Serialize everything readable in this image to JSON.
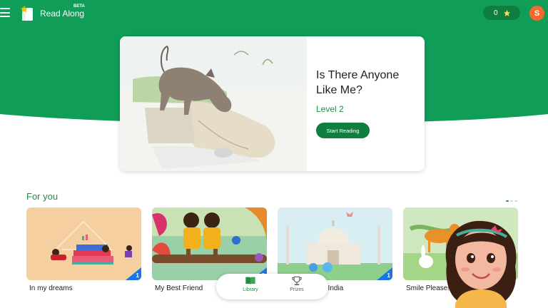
{
  "header": {
    "app_title": "Read Along",
    "beta": "BETA",
    "stars_count": "0",
    "avatar_initial": "S"
  },
  "featured": {
    "title": "Is There Anyone Like Me?",
    "level": "Level 2",
    "button_label": "Start  Reading"
  },
  "for_you": {
    "section_title": "For you",
    "books": [
      {
        "title": "In my dreams",
        "badge": "1"
      },
      {
        "title": "My Best Friend",
        "badge": "2"
      },
      {
        "title": "in India",
        "badge": "1"
      },
      {
        "title": "Smile Please!",
        "badge": ""
      }
    ]
  },
  "bottom_nav": {
    "items": [
      {
        "label": "Library",
        "icon": "book-icon"
      },
      {
        "label": "Prizes",
        "icon": "trophy-icon"
      }
    ]
  },
  "colors": {
    "brand_green": "#1e8e3e",
    "hero_green": "#0f9d58",
    "dark_green": "#0e7f3e",
    "avatar_orange": "#f26a2e",
    "badge_blue": "#1a73e8"
  }
}
